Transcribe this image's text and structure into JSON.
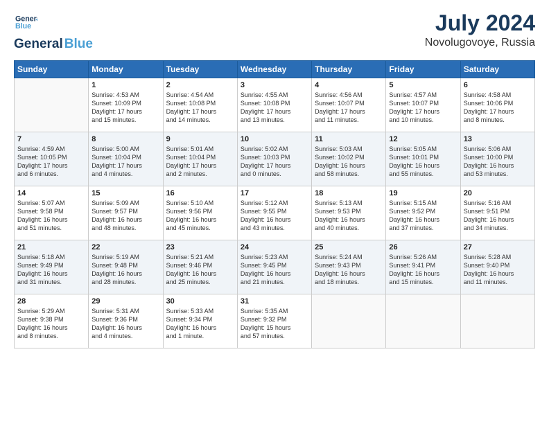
{
  "header": {
    "logo_line1": "General",
    "logo_line2": "Blue",
    "month_year": "July 2024",
    "location": "Novolugovoye, Russia"
  },
  "weekdays": [
    "Sunday",
    "Monday",
    "Tuesday",
    "Wednesday",
    "Thursday",
    "Friday",
    "Saturday"
  ],
  "weeks": [
    [
      {
        "day": "",
        "info": ""
      },
      {
        "day": "1",
        "info": "Sunrise: 4:53 AM\nSunset: 10:09 PM\nDaylight: 17 hours\nand 15 minutes."
      },
      {
        "day": "2",
        "info": "Sunrise: 4:54 AM\nSunset: 10:08 PM\nDaylight: 17 hours\nand 14 minutes."
      },
      {
        "day": "3",
        "info": "Sunrise: 4:55 AM\nSunset: 10:08 PM\nDaylight: 17 hours\nand 13 minutes."
      },
      {
        "day": "4",
        "info": "Sunrise: 4:56 AM\nSunset: 10:07 PM\nDaylight: 17 hours\nand 11 minutes."
      },
      {
        "day": "5",
        "info": "Sunrise: 4:57 AM\nSunset: 10:07 PM\nDaylight: 17 hours\nand 10 minutes."
      },
      {
        "day": "6",
        "info": "Sunrise: 4:58 AM\nSunset: 10:06 PM\nDaylight: 17 hours\nand 8 minutes."
      }
    ],
    [
      {
        "day": "7",
        "info": "Sunrise: 4:59 AM\nSunset: 10:05 PM\nDaylight: 17 hours\nand 6 minutes."
      },
      {
        "day": "8",
        "info": "Sunrise: 5:00 AM\nSunset: 10:04 PM\nDaylight: 17 hours\nand 4 minutes."
      },
      {
        "day": "9",
        "info": "Sunrise: 5:01 AM\nSunset: 10:04 PM\nDaylight: 17 hours\nand 2 minutes."
      },
      {
        "day": "10",
        "info": "Sunrise: 5:02 AM\nSunset: 10:03 PM\nDaylight: 17 hours\nand 0 minutes."
      },
      {
        "day": "11",
        "info": "Sunrise: 5:03 AM\nSunset: 10:02 PM\nDaylight: 16 hours\nand 58 minutes."
      },
      {
        "day": "12",
        "info": "Sunrise: 5:05 AM\nSunset: 10:01 PM\nDaylight: 16 hours\nand 55 minutes."
      },
      {
        "day": "13",
        "info": "Sunrise: 5:06 AM\nSunset: 10:00 PM\nDaylight: 16 hours\nand 53 minutes."
      }
    ],
    [
      {
        "day": "14",
        "info": "Sunrise: 5:07 AM\nSunset: 9:58 PM\nDaylight: 16 hours\nand 51 minutes."
      },
      {
        "day": "15",
        "info": "Sunrise: 5:09 AM\nSunset: 9:57 PM\nDaylight: 16 hours\nand 48 minutes."
      },
      {
        "day": "16",
        "info": "Sunrise: 5:10 AM\nSunset: 9:56 PM\nDaylight: 16 hours\nand 45 minutes."
      },
      {
        "day": "17",
        "info": "Sunrise: 5:12 AM\nSunset: 9:55 PM\nDaylight: 16 hours\nand 43 minutes."
      },
      {
        "day": "18",
        "info": "Sunrise: 5:13 AM\nSunset: 9:53 PM\nDaylight: 16 hours\nand 40 minutes."
      },
      {
        "day": "19",
        "info": "Sunrise: 5:15 AM\nSunset: 9:52 PM\nDaylight: 16 hours\nand 37 minutes."
      },
      {
        "day": "20",
        "info": "Sunrise: 5:16 AM\nSunset: 9:51 PM\nDaylight: 16 hours\nand 34 minutes."
      }
    ],
    [
      {
        "day": "21",
        "info": "Sunrise: 5:18 AM\nSunset: 9:49 PM\nDaylight: 16 hours\nand 31 minutes."
      },
      {
        "day": "22",
        "info": "Sunrise: 5:19 AM\nSunset: 9:48 PM\nDaylight: 16 hours\nand 28 minutes."
      },
      {
        "day": "23",
        "info": "Sunrise: 5:21 AM\nSunset: 9:46 PM\nDaylight: 16 hours\nand 25 minutes."
      },
      {
        "day": "24",
        "info": "Sunrise: 5:23 AM\nSunset: 9:45 PM\nDaylight: 16 hours\nand 21 minutes."
      },
      {
        "day": "25",
        "info": "Sunrise: 5:24 AM\nSunset: 9:43 PM\nDaylight: 16 hours\nand 18 minutes."
      },
      {
        "day": "26",
        "info": "Sunrise: 5:26 AM\nSunset: 9:41 PM\nDaylight: 16 hours\nand 15 minutes."
      },
      {
        "day": "27",
        "info": "Sunrise: 5:28 AM\nSunset: 9:40 PM\nDaylight: 16 hours\nand 11 minutes."
      }
    ],
    [
      {
        "day": "28",
        "info": "Sunrise: 5:29 AM\nSunset: 9:38 PM\nDaylight: 16 hours\nand 8 minutes."
      },
      {
        "day": "29",
        "info": "Sunrise: 5:31 AM\nSunset: 9:36 PM\nDaylight: 16 hours\nand 4 minutes."
      },
      {
        "day": "30",
        "info": "Sunrise: 5:33 AM\nSunset: 9:34 PM\nDaylight: 16 hours\nand 1 minute."
      },
      {
        "day": "31",
        "info": "Sunrise: 5:35 AM\nSunset: 9:32 PM\nDaylight: 15 hours\nand 57 minutes."
      },
      {
        "day": "",
        "info": ""
      },
      {
        "day": "",
        "info": ""
      },
      {
        "day": "",
        "info": ""
      }
    ]
  ]
}
